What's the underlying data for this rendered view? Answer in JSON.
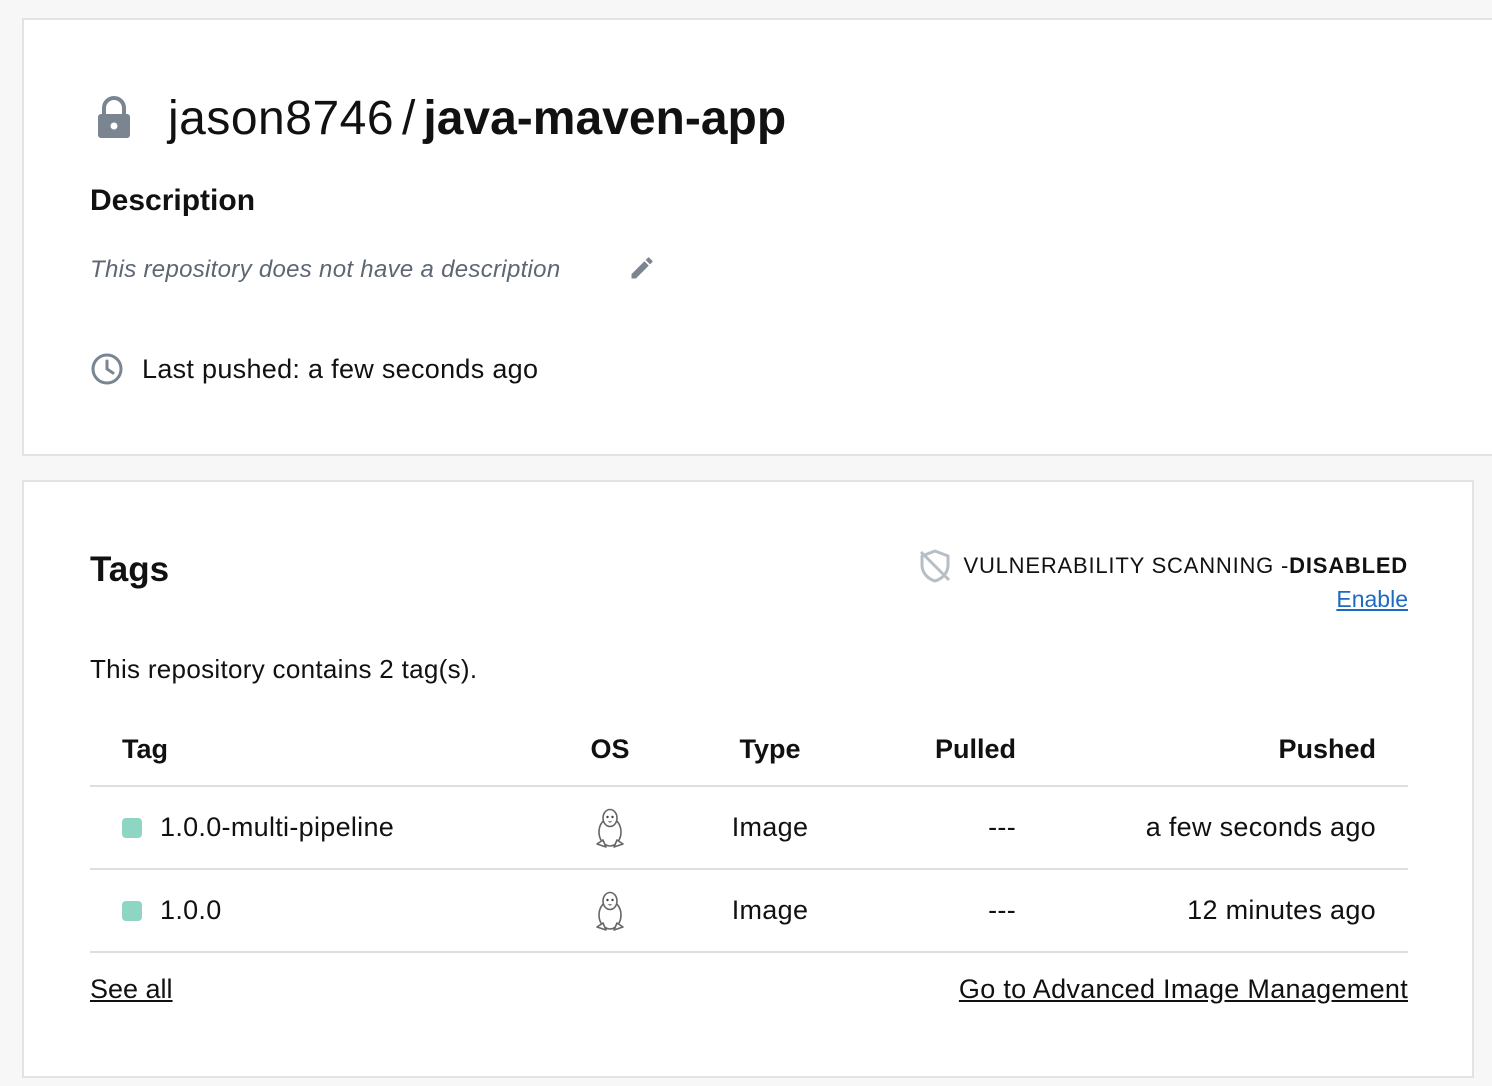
{
  "repo": {
    "namespace": "jason8746",
    "separator": "/",
    "name": "java-maven-app",
    "lock_icon": "lock-icon"
  },
  "description": {
    "heading": "Description",
    "text": "This repository does not have a description",
    "edit_icon": "pencil-icon"
  },
  "last_pushed": {
    "text": "Last pushed: a few seconds ago",
    "icon": "clock-icon"
  },
  "tags": {
    "heading": "Tags",
    "vuln_label": "VULNERABILITY SCANNING - ",
    "vuln_status": "DISABLED",
    "enable_label": "Enable",
    "count_text": "This repository contains 2 tag(s).",
    "columns": [
      "Tag",
      "OS",
      "Type",
      "Pulled",
      "Pushed"
    ],
    "rows": [
      {
        "tag": "1.0.0-multi-pipeline",
        "os": "linux-icon",
        "type": "Image",
        "pulled": "---",
        "pushed": "a few seconds ago"
      },
      {
        "tag": "1.0.0",
        "os": "linux-icon",
        "type": "Image",
        "pulled": "---",
        "pushed": "12 minutes ago"
      }
    ],
    "see_all_label": "See all",
    "advanced_label": "Go to Advanced Image Management"
  },
  "colors": {
    "tag_dot": "#8ed6c3",
    "link_blue": "#1c6bc1",
    "muted_text": "#5e6673"
  }
}
